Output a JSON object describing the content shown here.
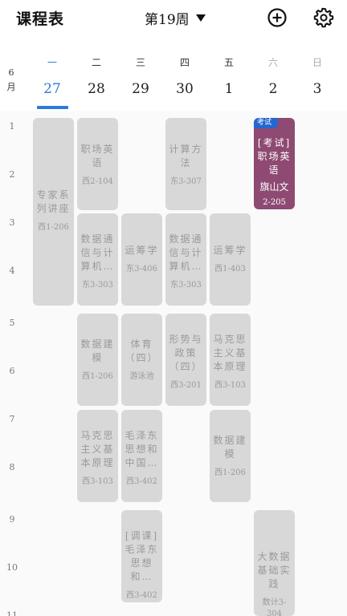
{
  "header": {
    "title": "课程表",
    "week_label": "第19周",
    "dropdown_icon": "triangle-down-icon",
    "add_icon": "plus-circle-icon",
    "settings_icon": "gear-icon"
  },
  "day_header": {
    "month": "6月",
    "days": [
      {
        "weekday": "一",
        "date": "27",
        "today": true
      },
      {
        "weekday": "二",
        "date": "28"
      },
      {
        "weekday": "三",
        "date": "29"
      },
      {
        "weekday": "四",
        "date": "30"
      },
      {
        "weekday": "五",
        "date": "1"
      },
      {
        "weekday": "六",
        "date": "2"
      },
      {
        "weekday": "日",
        "date": "3"
      }
    ]
  },
  "periods": [
    "1",
    "2",
    "3",
    "4",
    "5",
    "6",
    "7",
    "8",
    "9",
    "10",
    "11"
  ],
  "colors": {
    "accent": "#2b7bd8",
    "inactive_course": "#d8d8d8",
    "exam_course": "#8e4a72",
    "exam_badge": "#2467d0"
  },
  "courses": [
    {
      "name": "专家系列讲座",
      "room": "西1-206"
    },
    {
      "name": "职场英语",
      "room": "西2-104"
    },
    {
      "name": "计算方法",
      "room": "东3-307"
    },
    {
      "name": "[考试]职场英语",
      "teacher": "旗山文",
      "room": "2-205",
      "badge": "考试"
    },
    {
      "name": "数据通信与计算机…",
      "room": "东3-303"
    },
    {
      "name": "运筹学",
      "room": "东3-406"
    },
    {
      "name": "数据通信与计算机…",
      "room": "东3-303"
    },
    {
      "name": "运筹学",
      "room": "西1-403"
    },
    {
      "name": "数据建模",
      "room": "西1-206"
    },
    {
      "name": "体育（四）",
      "room": "游泳池"
    },
    {
      "name": "形势与政策（四）",
      "room": "西3-201"
    },
    {
      "name": "马克思主义基本原理",
      "room": "西3-103"
    },
    {
      "name": "马克思主义基本原理",
      "room": "西3-103"
    },
    {
      "name": "毛泽东思想和中国…",
      "room": "西3-402"
    },
    {
      "name": "数据建模",
      "room": "西1-206"
    },
    {
      "name": "[调课]毛泽东思想和…",
      "room": "西3-402"
    },
    {
      "name": "大数据基础实践",
      "room": "数计3-304"
    }
  ]
}
